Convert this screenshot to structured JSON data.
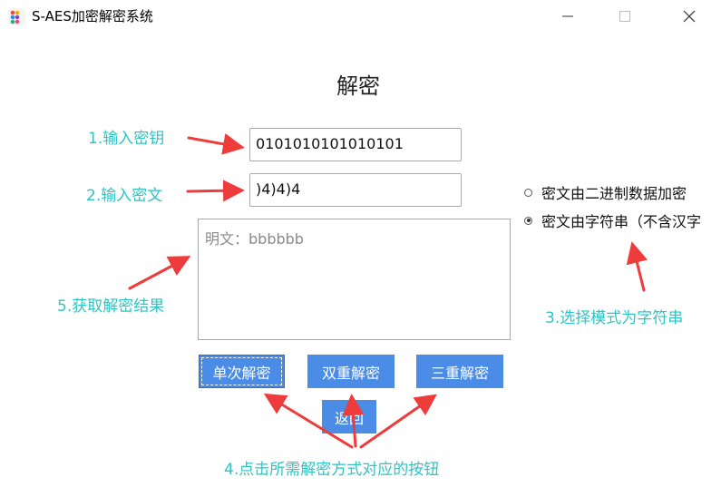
{
  "window": {
    "title": "S-AES加密解密系统",
    "controls": [
      "minimize-icon",
      "maximize-icon",
      "close-icon"
    ]
  },
  "heading": "解密",
  "form": {
    "key_value": "0101010101010101",
    "ciphertext_value": ")4)4)4",
    "plaintext_output": "明文：bbbbbb"
  },
  "modes": [
    {
      "label": "密文由二进制数据加密",
      "checked": false
    },
    {
      "label": "密文由字符串（不含汉字",
      "checked": true
    }
  ],
  "buttons": {
    "single": "单次解密",
    "double": "双重解密",
    "triple": "三重解密",
    "back": "返回"
  },
  "annotations": {
    "step1": "1.输入密钥",
    "step2": "2.输入密文",
    "step3": "3.选择模式为字符串",
    "step4": "4.点击所需解密方式对应的按钮",
    "step5": "5.获取解密结果"
  },
  "colors": {
    "annotation_text": "#2ec4c4",
    "arrow": "#ee3b3b",
    "button": "#4a8ce6"
  }
}
